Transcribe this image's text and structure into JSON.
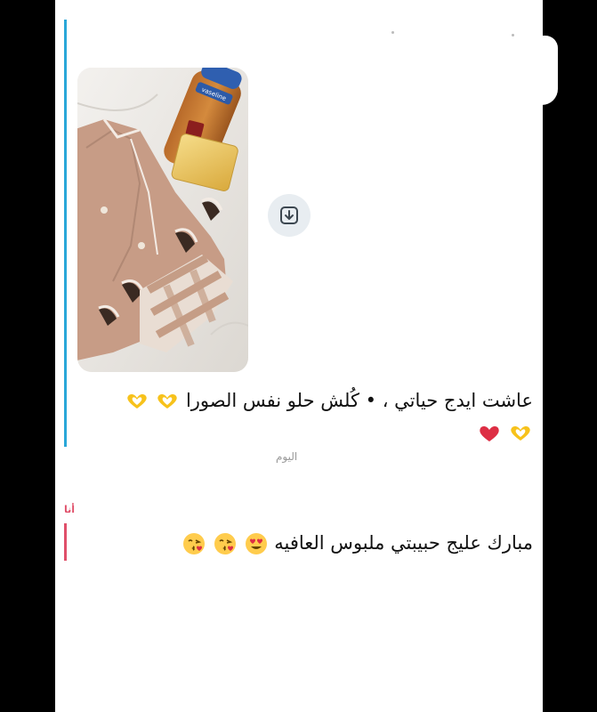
{
  "messages": [
    {
      "text": "عاشت ايدج حياتي ، • كُلش حلو نفس الصورا",
      "emojis": [
        "heart-hands-emoji",
        "heart-hands-emoji",
        "heart-hands-emoji",
        "red-heart-emoji"
      ],
      "has_photo": true,
      "accent_color": "#2aa7d8"
    },
    {
      "sender": "أنا",
      "text": "مبارك عليج حبيبتي ملبوس العافيه",
      "emojis": [
        "heart-eyes-emoji",
        "kissing-heart-emoji",
        "kissing-heart-emoji"
      ],
      "accent_color": "#e0506a"
    }
  ],
  "divider": {
    "day_label": "اليوم"
  },
  "icons": {
    "download": "download-icon"
  }
}
